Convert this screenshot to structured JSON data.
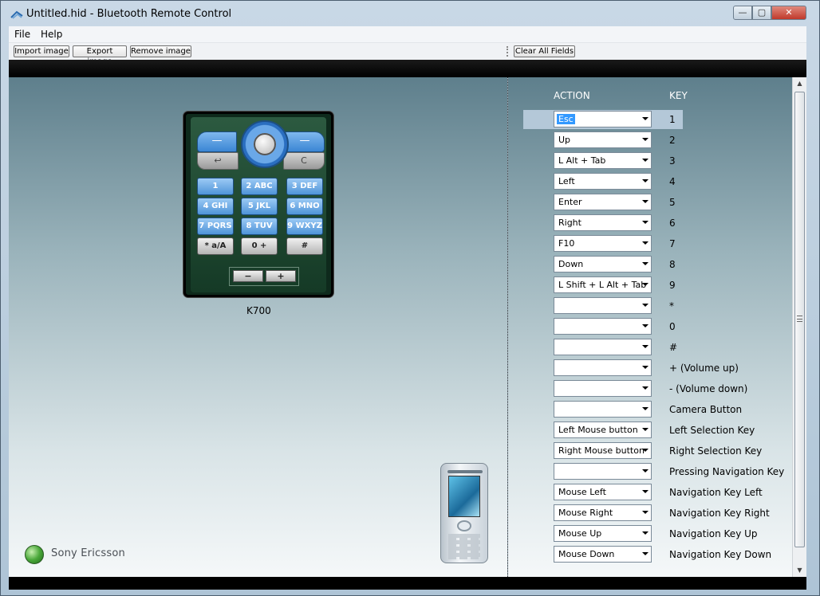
{
  "window": {
    "title": "Untitled.hid - Bluetooth Remote Control",
    "minimize": "—",
    "maximize": "▢",
    "close": "✕"
  },
  "menu": [
    "File",
    "Help"
  ],
  "toolbar": {
    "import_label": "Import image",
    "export_label": "Export image",
    "remove_label": "Remove image",
    "clear_label": "Clear All Fields"
  },
  "phone": {
    "model_label": "K700",
    "brand": "Sony Ericsson",
    "keys": [
      "1",
      "2 ABC",
      "3 DEF",
      "4 GHI",
      "5 JKL",
      "6 MNO",
      "7 PQRS",
      "8 TUV",
      "9 WXYZ",
      "* a/A",
      "0 +",
      "#"
    ],
    "soft_left": "—",
    "soft_right": "—",
    "back": "↩",
    "clear": "C",
    "vol_minus": "−",
    "vol_plus": "+"
  },
  "table": {
    "action_header": "ACTION",
    "key_header": "KEY",
    "rows": [
      {
        "action": "Esc",
        "key": "1"
      },
      {
        "action": "Up",
        "key": "2"
      },
      {
        "action": "L Alt + Tab",
        "key": "3"
      },
      {
        "action": "Left",
        "key": "4"
      },
      {
        "action": "Enter",
        "key": "5"
      },
      {
        "action": "Right",
        "key": "6"
      },
      {
        "action": "F10",
        "key": "7"
      },
      {
        "action": "Down",
        "key": "8"
      },
      {
        "action": "L Shift + L Alt + Tab",
        "key": "9"
      },
      {
        "action": "",
        "key": "*"
      },
      {
        "action": "",
        "key": "0"
      },
      {
        "action": "",
        "key": "#"
      },
      {
        "action": "",
        "key": "+ (Volume up)"
      },
      {
        "action": "",
        "key": "- (Volume down)"
      },
      {
        "action": "",
        "key": "Camera Button"
      },
      {
        "action": "Left Mouse button",
        "key": "Left Selection Key"
      },
      {
        "action": "Right Mouse button",
        "key": "Right Selection Key"
      },
      {
        "action": "",
        "key": "Pressing Navigation Key"
      },
      {
        "action": "Mouse Left",
        "key": "Navigation Key Left"
      },
      {
        "action": "Mouse Right",
        "key": "Navigation Key Right"
      },
      {
        "action": "Mouse Up",
        "key": "Navigation Key Up"
      },
      {
        "action": "Mouse Down",
        "key": "Navigation Key Down"
      }
    ]
  },
  "scroll": {
    "up": "▲",
    "down": "▼"
  }
}
